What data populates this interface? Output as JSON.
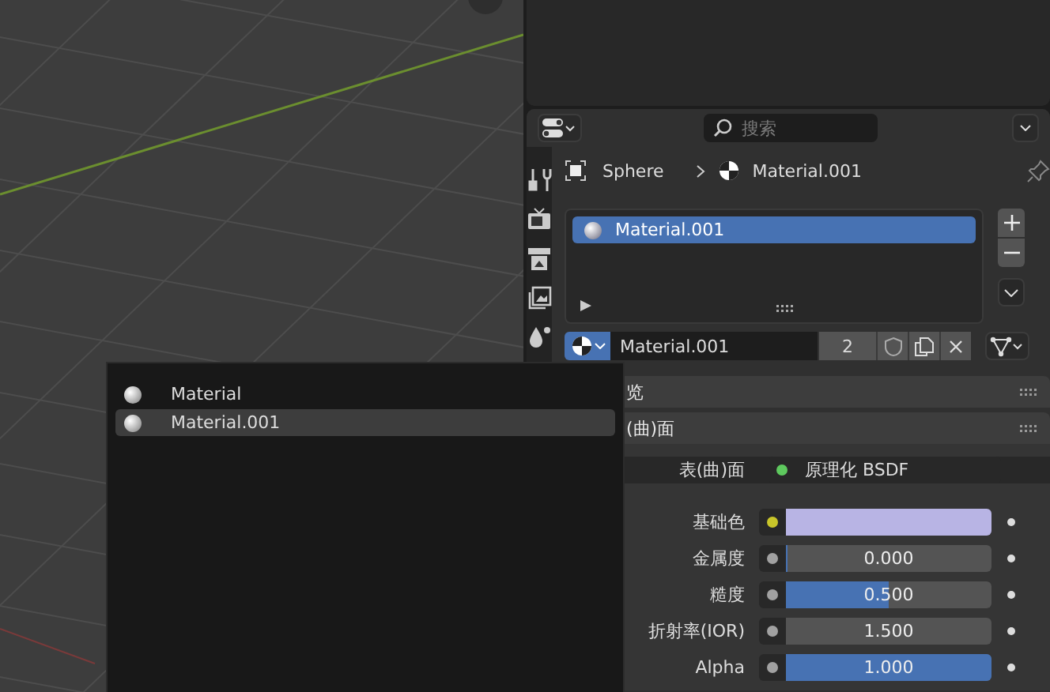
{
  "properties": {
    "search": {
      "placeholder": "搜索"
    },
    "breadcrumb": [
      "Sphere",
      "Material.001"
    ],
    "slots": [
      {
        "name": "Material.001",
        "selected": true
      }
    ],
    "material_selector": {
      "name": "Material.001",
      "users": "2"
    },
    "panels": [
      {
        "title": "览"
      },
      {
        "title": "(曲)面",
        "rows": [
          {
            "kind": "shader",
            "label": "表(曲)面",
            "value": "原理化 BSDF",
            "socket": {
              "color": "#5ec95e"
            }
          },
          {
            "kind": "color",
            "label": "基础色",
            "swatch": {
              "color": "#b8b4e4"
            },
            "socket": {
              "color": "#c9c62a"
            }
          },
          {
            "kind": "slider",
            "label": "金属度",
            "value": "0.000",
            "level": 0,
            "socket": {
              "color": "#a1a1a1"
            }
          },
          {
            "kind": "slider",
            "label": "糙度",
            "value": "0.500",
            "level": 0.5,
            "socket": {
              "color": "#a1a1a1"
            }
          },
          {
            "kind": "number",
            "label": "折射率(IOR)",
            "value": "1.500",
            "socket": {
              "color": "#a1a1a1"
            }
          },
          {
            "kind": "slider",
            "label": "Alpha",
            "value": "1.000",
            "level": 1,
            "socket": {
              "color": "#a1a1a1"
            }
          }
        ]
      }
    ]
  },
  "popup": {
    "items": [
      {
        "name": "Material",
        "selected": false
      },
      {
        "name": "Material.001",
        "selected": true
      }
    ]
  }
}
